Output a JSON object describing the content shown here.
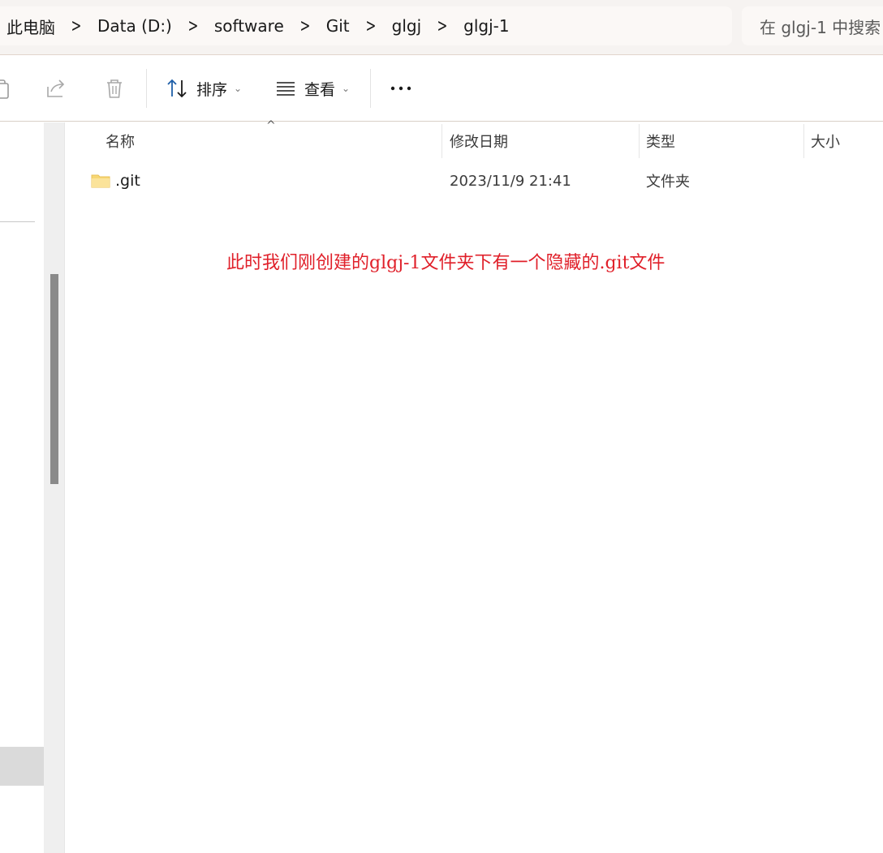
{
  "breadcrumb": {
    "items": [
      "此电脑",
      "Data (D:)",
      "software",
      "Git",
      "glgj",
      "glgj-1"
    ]
  },
  "search": {
    "placeholder": "在 glgj-1 中搜索"
  },
  "toolbar": {
    "sort_label": "排序",
    "view_label": "查看",
    "more_label": "..."
  },
  "columns": {
    "name": "名称",
    "modified": "修改日期",
    "type": "类型",
    "size": "大小"
  },
  "files": [
    {
      "name": ".git",
      "modified": "2023/11/9 21:41",
      "type": "文件夹",
      "size": ""
    }
  ],
  "annotation": {
    "text": "此时我们刚创建的glgj-1文件夹下有一个隐藏的.git文件"
  },
  "colors": {
    "annotation": "#e0202a",
    "folder": "#f7d774",
    "accent": "#005fb8"
  }
}
